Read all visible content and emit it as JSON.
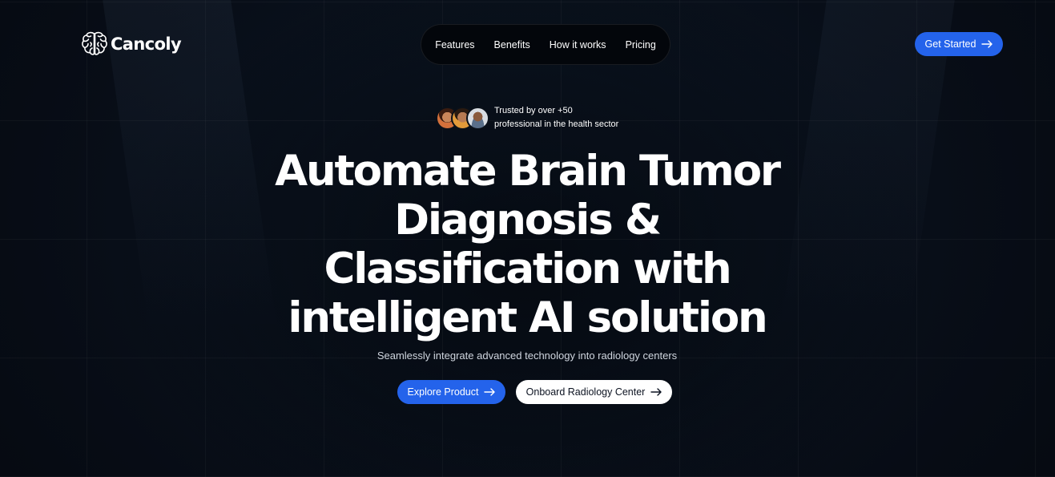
{
  "brand": {
    "name": "Cancoly",
    "logo_icon": "brain-icon"
  },
  "nav": {
    "items": [
      {
        "label": "Features"
      },
      {
        "label": "Benefits"
      },
      {
        "label": "How it works"
      },
      {
        "label": "Pricing"
      }
    ]
  },
  "header": {
    "cta_label": "Get Started",
    "cta_icon": "arrow-right-icon"
  },
  "trust": {
    "line1": "Trusted by over +50",
    "line2": "professional in the health sector"
  },
  "hero": {
    "title_lines": [
      "Automate Brain Tumor",
      "Diagnosis &",
      "Classification with",
      "intelligent AI solution"
    ],
    "subtitle": "Seamlessly integrate advanced technology into radiology centers",
    "primary_cta": "Explore Product",
    "secondary_cta": "Onboard Radiology Center"
  },
  "colors": {
    "background": "#070d16",
    "accent": "#2463eb",
    "text": "#ffffff",
    "secondary_button": "#ffffff"
  }
}
